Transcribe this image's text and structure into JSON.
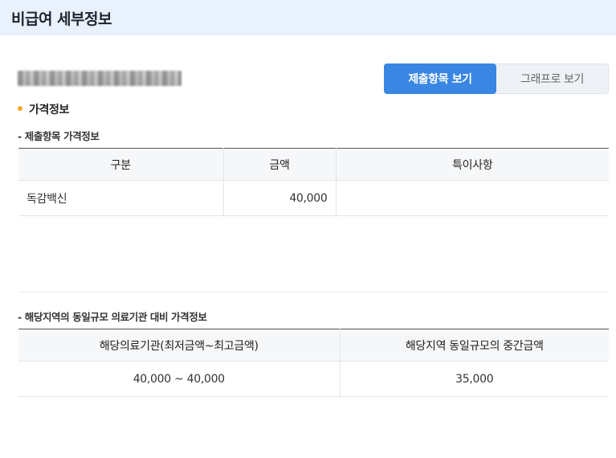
{
  "header": {
    "title": "비급여 세부정보"
  },
  "buttons": {
    "submitted_items": "제출항목 보기",
    "graph_view": "그래프로 보기"
  },
  "section": {
    "title": "가격정보"
  },
  "submitted": {
    "subtitle": "- 제출항목 가격정보",
    "columns": [
      "구분",
      "금액",
      "특이사항"
    ],
    "rows": [
      {
        "category": "독감백신",
        "amount": "40,000",
        "note": ""
      }
    ]
  },
  "regional": {
    "subtitle": "- 해당지역의 동일규모 의료기관 대비 가격정보",
    "columns": [
      "해당의료기관(최저금액~최고금액)",
      "해당지역 동일규모의 중간금액"
    ],
    "rows": [
      {
        "range": "40,000 ~ 40,000",
        "median": "35,000"
      }
    ]
  }
}
